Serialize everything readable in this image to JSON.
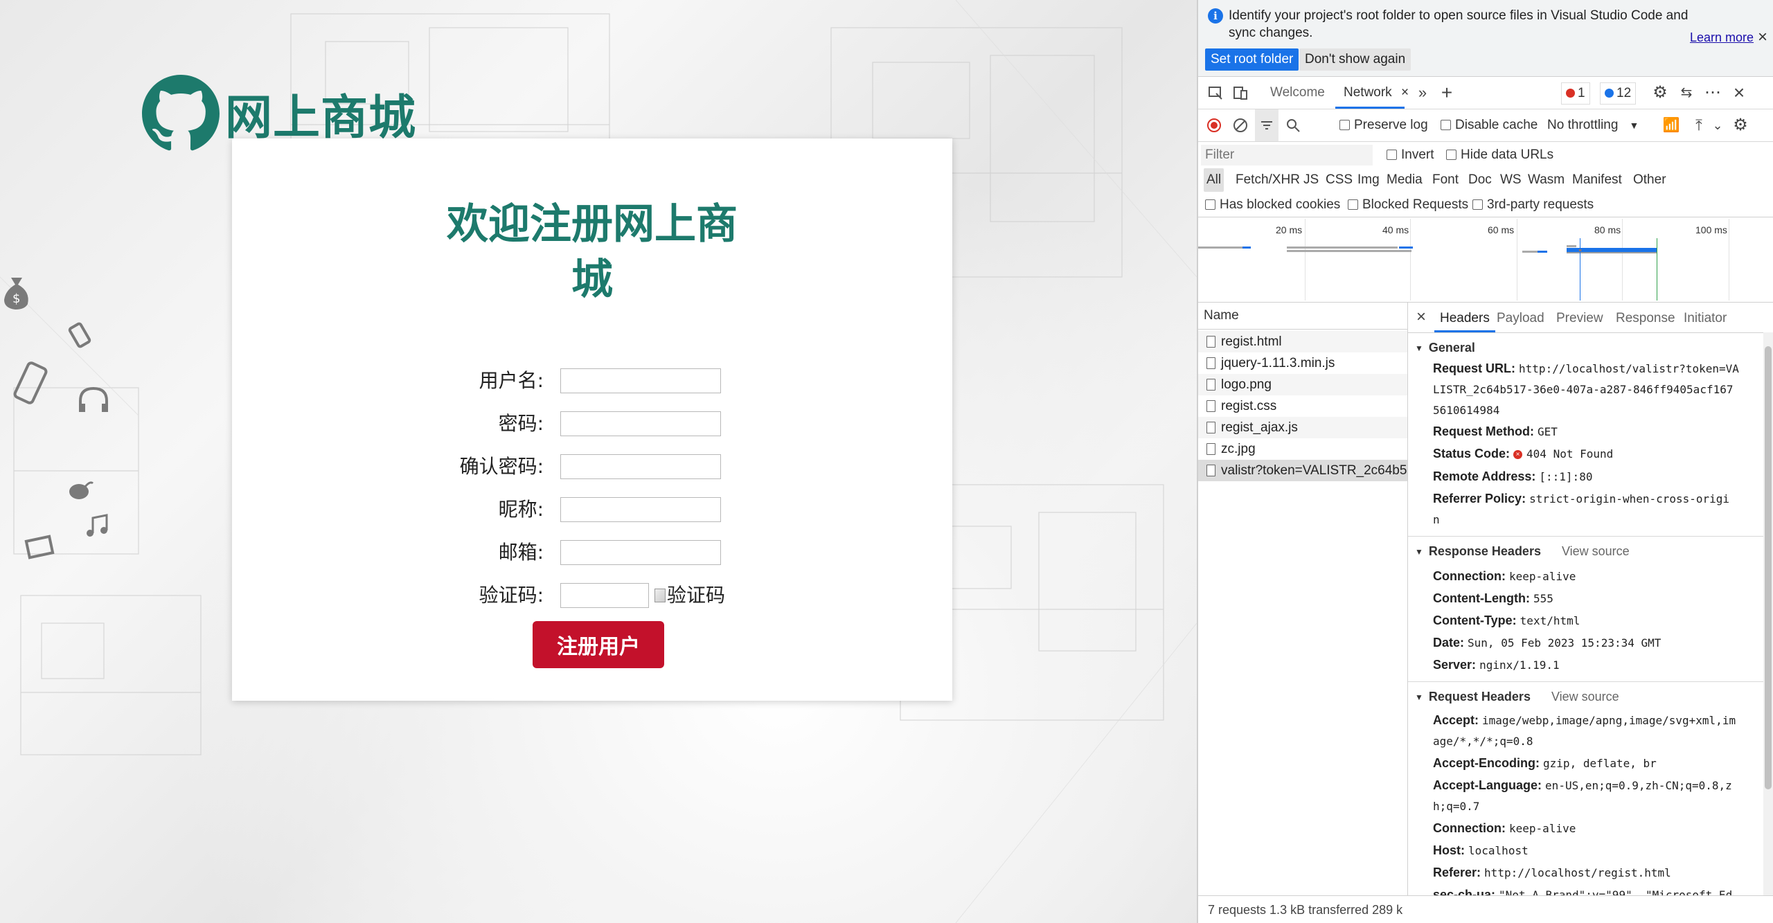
{
  "page": {
    "logo_text": "网上商城",
    "title": "欢迎注册网上商城",
    "fields": [
      {
        "label": "用户名:",
        "value": ""
      },
      {
        "label": "密码:",
        "value": ""
      },
      {
        "label": "确认密码:",
        "value": ""
      },
      {
        "label": "昵称:",
        "value": ""
      },
      {
        "label": "邮箱:",
        "value": ""
      },
      {
        "label": "验证码:",
        "value": ""
      }
    ],
    "captcha_alt": "验证码",
    "submit_label": "注册用户",
    "accent_color": "#1d7a6c",
    "button_color": "#c3112b"
  },
  "devtools": {
    "infobar": {
      "text": "Identify your project's root folder to open source files in Visual Studio Code and sync changes.",
      "learn_more": "Learn more",
      "set_root": "Set root folder",
      "dont_show": "Don't show again"
    },
    "tabs": {
      "welcome": "Welcome",
      "network": "Network",
      "errors": "1",
      "messages": "12"
    },
    "toolbar": {
      "preserve_log": "Preserve log",
      "disable_cache": "Disable cache",
      "throttling": "No throttling"
    },
    "filter": {
      "placeholder": "Filter",
      "invert": "Invert",
      "hide_data_urls": "Hide data URLs"
    },
    "types": [
      "All",
      "Fetch/XHR",
      "JS",
      "CSS",
      "Img",
      "Media",
      "Font",
      "Doc",
      "WS",
      "Wasm",
      "Manifest",
      "Other"
    ],
    "checks": {
      "blocked_cookies": "Has blocked cookies",
      "blocked_requests": "Blocked Requests",
      "third_party": "3rd-party requests"
    },
    "timeline_ticks": [
      "20 ms",
      "40 ms",
      "60 ms",
      "80 ms",
      "100 ms"
    ],
    "name_header": "Name",
    "requests": [
      "regist.html",
      "jquery-1.11.3.min.js",
      "logo.png",
      "regist.css",
      "regist_ajax.js",
      "zc.jpg",
      "valistr?token=VALISTR_2c64b5..."
    ],
    "detail_tabs": [
      "Headers",
      "Payload",
      "Preview",
      "Response",
      "Initiator"
    ],
    "general": {
      "title": "General",
      "request_url_label": "Request URL:",
      "request_url_1": "http://localhost/valistr?token=VA",
      "request_url_2": "LISTR_2c64b517-36e0-407a-a287-846ff9405acf167",
      "request_url_3": "5610614984",
      "method_label": "Request Method:",
      "method": "GET",
      "status_label": "Status Code:",
      "status": "404 Not Found",
      "remote_label": "Remote Address:",
      "remote": "[::1]:80",
      "referrer_label": "Referrer Policy:",
      "referrer_1": "strict-origin-when-cross-origi",
      "referrer_2": "n"
    },
    "response_headers": {
      "title": "Response Headers",
      "view_source": "View source",
      "items": [
        {
          "k": "Connection:",
          "v": "keep-alive"
        },
        {
          "k": "Content-Length:",
          "v": "555"
        },
        {
          "k": "Content-Type:",
          "v": "text/html"
        },
        {
          "k": "Date:",
          "v": "Sun, 05 Feb 2023 15:23:34 GMT"
        },
        {
          "k": "Server:",
          "v": "nginx/1.19.1"
        }
      ]
    },
    "request_headers": {
      "title": "Request Headers",
      "view_source": "View source",
      "accept_label": "Accept:",
      "accept_1": "image/webp,image/apng,image/svg+xml,im",
      "accept_2": "age/*,*/*;q=0.8",
      "encoding_label": "Accept-Encoding:",
      "encoding": "gzip, deflate, br",
      "language_label": "Accept-Language:",
      "language_1": "en-US,en;q=0.9,zh-CN;q=0.8,z",
      "language_2": "h;q=0.7",
      "connection_label": "Connection:",
      "connection": "keep-alive",
      "host_label": "Host:",
      "host": "localhost",
      "referer_label": "Referer:",
      "referer": "http://localhost/regist.html",
      "secchua_label": "sec-ch-ua:",
      "secchua": "\"Not_A Brand\";v=\"99\", \"Microsoft Ed"
    },
    "statusbar": "7 requests   1.3 kB transferred   289 k"
  }
}
